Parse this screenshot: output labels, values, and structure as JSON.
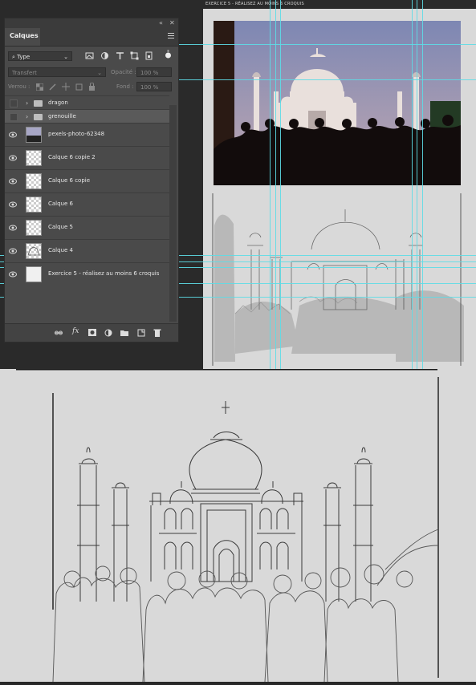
{
  "document": {
    "title": "EXERCICE 5 - RÉALISEZ AU MOINS 6 CROQUIS"
  },
  "layers_panel": {
    "tab_label": "Calques",
    "filter": {
      "label": "Type",
      "icon": "search-icon"
    },
    "blend_mode": "Transfert",
    "opacity_label": "Opacité :",
    "opacity_value": "100 %",
    "lock_label": "Verrou :",
    "fill_label": "Fond :",
    "fill_value": "100 %",
    "groups": [
      {
        "name": "dragon"
      },
      {
        "name": "grenouille"
      }
    ],
    "layers": [
      {
        "name": "pexels-photo-62348",
        "thumb": "photo"
      },
      {
        "name": "Calque 6 copie 2",
        "thumb": "transparent"
      },
      {
        "name": "Calque 6 copie",
        "thumb": "transparent"
      },
      {
        "name": "Calque 6",
        "thumb": "transparent"
      },
      {
        "name": "Calque 5",
        "thumb": "transparent"
      },
      {
        "name": "Calque 4",
        "thumb": "sketch"
      },
      {
        "name": "Exercice 5 - réalisez au moins 6 croquis",
        "thumb": "white"
      }
    ],
    "bottom_icons": [
      "link-icon",
      "fx-icon",
      "mask-icon",
      "adjustment-icon",
      "folder-icon",
      "new-layer-icon",
      "trash-icon"
    ]
  },
  "colors": {
    "guide": "#5ddbe6",
    "panel_bg": "#4a4a4a",
    "canvas_bg": "#d9d9d9"
  }
}
